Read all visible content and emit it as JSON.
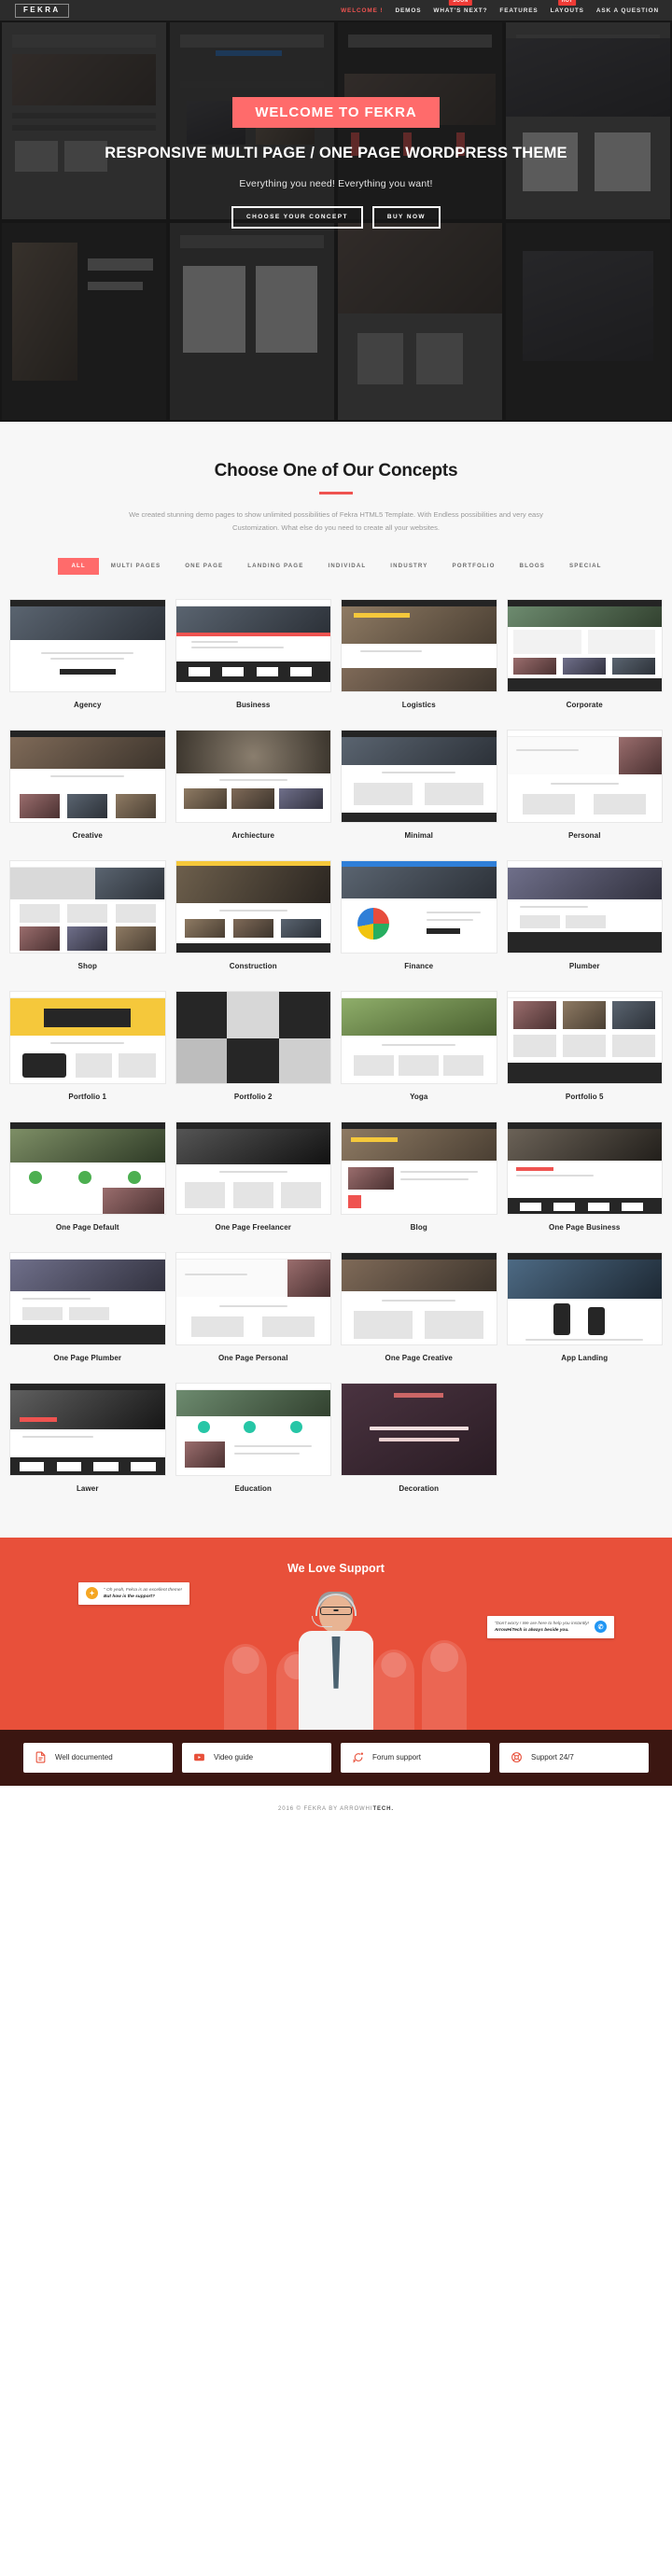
{
  "header": {
    "logo": "FEKRA",
    "nav": [
      {
        "label": "WELCOME !",
        "active": true,
        "badge": null
      },
      {
        "label": "DEMOS",
        "active": false,
        "badge": null
      },
      {
        "label": "WHAT'S NEXT?",
        "active": false,
        "badge": "SOON"
      },
      {
        "label": "FEATURES",
        "active": false,
        "badge": null
      },
      {
        "label": "LAYOUTS",
        "active": false,
        "badge": "HOT"
      },
      {
        "label": "ASK A QUESTION",
        "active": false,
        "badge": null
      }
    ]
  },
  "hero": {
    "badge": "WELCOME TO FEKRA",
    "title": "RESPONSIVE MULTI PAGE / ONE PAGE WORDPRESS THEME",
    "subtitle": "Everything you need! Everything you want!",
    "buttons": [
      {
        "label": "CHOOSE YOUR CONCEPT"
      },
      {
        "label": "BUY NOW"
      }
    ]
  },
  "concepts": {
    "title": "Choose One of Our Concepts",
    "description": "We created stunning demo pages to show unlimited possibilities of Fekra HTML5 Template. With Endless possibilities and very easy Customization. What else do you need to create all your websites.",
    "filters": [
      {
        "label": "ALL",
        "active": true
      },
      {
        "label": "MULTI PAGES",
        "active": false
      },
      {
        "label": "ONE PAGE",
        "active": false
      },
      {
        "label": "LANDING PAGE",
        "active": false
      },
      {
        "label": "INDIVIDAL",
        "active": false
      },
      {
        "label": "INDUSTRY",
        "active": false
      },
      {
        "label": "PORTFOLIO",
        "active": false
      },
      {
        "label": "BLOGS",
        "active": false
      },
      {
        "label": "SPECIAL",
        "active": false
      }
    ],
    "demos": [
      {
        "label": "Agency",
        "style": "agency"
      },
      {
        "label": "Business",
        "style": "business"
      },
      {
        "label": "Logistics",
        "style": "logistics"
      },
      {
        "label": "Corporate",
        "style": "corporate"
      },
      {
        "label": "Creative",
        "style": "creative"
      },
      {
        "label": "Archiecture",
        "style": "architecture"
      },
      {
        "label": "Minimal",
        "style": "minimal"
      },
      {
        "label": "Personal",
        "style": "personal"
      },
      {
        "label": "Shop",
        "style": "shop"
      },
      {
        "label": "Construction",
        "style": "construction"
      },
      {
        "label": "Finance",
        "style": "finance"
      },
      {
        "label": "Plumber",
        "style": "plumber"
      },
      {
        "label": "Portfolio 1",
        "style": "portfolio1"
      },
      {
        "label": "Portfolio 2",
        "style": "portfolio2"
      },
      {
        "label": "Yoga",
        "style": "yoga"
      },
      {
        "label": "Portfolio 5",
        "style": "portfolio5"
      },
      {
        "label": "One Page Default",
        "style": "onepagedefault"
      },
      {
        "label": "One Page Freelancer",
        "style": "onepagefreelancer"
      },
      {
        "label": "Blog",
        "style": "blog"
      },
      {
        "label": "One Page Business",
        "style": "onepagebusiness"
      },
      {
        "label": "One Page Plumber",
        "style": "onepageplumber"
      },
      {
        "label": "One Page Personal",
        "style": "onepagepersonal"
      },
      {
        "label": "One Page Creative",
        "style": "onepagecreative"
      },
      {
        "label": "App Landing",
        "style": "applanding"
      },
      {
        "label": "Lawer",
        "style": "lawer"
      },
      {
        "label": "Education",
        "style": "education"
      },
      {
        "label": "Decoration",
        "style": "decoration"
      }
    ]
  },
  "support": {
    "title": "We Love Support",
    "bubble_left": {
      "line1": "\" Oh yeah, Fekra is an excellent theme!",
      "line2": "But how is the support?"
    },
    "bubble_right": {
      "line1": "\"Don't worry ! We are here to help you instantly!",
      "line2": "ArrowHiTech is always beside you."
    },
    "features": [
      {
        "label": "Well documented",
        "icon": "document-icon"
      },
      {
        "label": "Video guide",
        "icon": "video-play-icon"
      },
      {
        "label": "Forum support",
        "icon": "chat-bubble-icon"
      },
      {
        "label": "Support 24/7",
        "icon": "lifebuoy-icon"
      }
    ]
  },
  "footer": {
    "prefix": "2016 © FEKRA BY ",
    "brand_light": "ARROWHI",
    "brand_bold": "TECH."
  },
  "colors": {
    "accent": "#ff6b6b",
    "support_bg": "#e8503a",
    "header_bg": "#2c2c2c",
    "strip_bg": "#3b1611"
  }
}
